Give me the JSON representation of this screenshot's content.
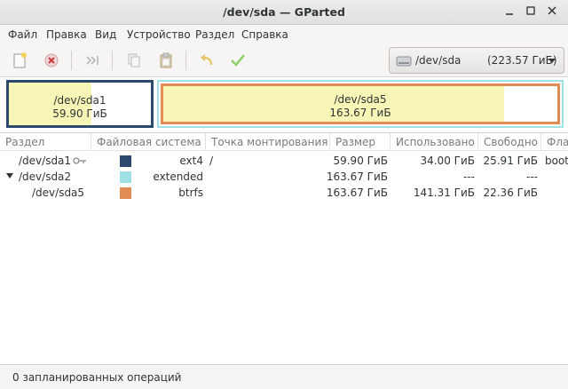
{
  "window": {
    "title": "/dev/sda — GParted",
    "controls": {
      "minimize": "_",
      "maximize": "□",
      "close": "×"
    }
  },
  "menu": {
    "items": [
      "Файл",
      "Правка",
      "Вид",
      "Устройство",
      "Раздел",
      "Справка"
    ]
  },
  "toolbar": {
    "icons": [
      "new-partition-icon",
      "delete-partition-icon",
      "resize-move-icon",
      "copy-icon",
      "paste-icon",
      "undo-icon",
      "apply-icon"
    ]
  },
  "device": {
    "name": "/dev/sda",
    "size": "(223.57 ГиБ)"
  },
  "graph": {
    "partitions": [
      {
        "name": "/dev/sda1",
        "size": "59.90 ГиБ",
        "color": "#2b4a6e"
      },
      {
        "name": "/dev/sda5",
        "size": "163.67 ГиБ",
        "color": "#e28b55"
      }
    ],
    "extended_color": "#9fe1e4"
  },
  "table": {
    "columns": [
      "Раздел",
      "Файловая система",
      "Точка монтирования",
      "Размер",
      "Использовано",
      "Свободно",
      "Флаги"
    ],
    "rows": [
      {
        "partition": "/dev/sda1",
        "fs": "ext4",
        "fs_color": "#2b4a6e",
        "mount": "/",
        "size": "59.90 ГиБ",
        "used": "34.00 ГиБ",
        "free": "25.91 ГиБ",
        "flags": "boot"
      },
      {
        "partition": "/dev/sda2",
        "fs": "extended",
        "fs_color": "#9fe1e4",
        "mount": "",
        "size": "163.67 ГиБ",
        "used": "---",
        "free": "---",
        "flags": ""
      },
      {
        "partition": "/dev/sda5",
        "fs": "btrfs",
        "fs_color": "#e28b55",
        "mount": "",
        "size": "163.67 ГиБ",
        "used": "141.31 ГиБ",
        "free": "22.36 ГиБ",
        "flags": ""
      }
    ]
  },
  "status": {
    "text": "0 запланированных операций"
  }
}
